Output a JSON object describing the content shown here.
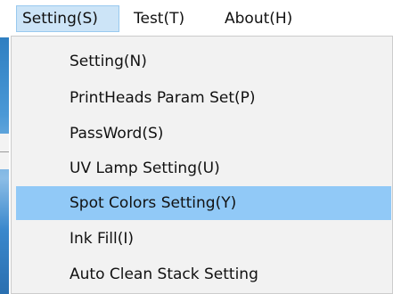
{
  "menubar": {
    "items": [
      {
        "label": "Setting(S)"
      },
      {
        "label": "Test(T)"
      },
      {
        "label": "About(H)"
      }
    ]
  },
  "dropdown": {
    "items": [
      {
        "label": "Setting(N)"
      },
      {
        "label": "PrintHeads Param Set(P)"
      },
      {
        "label": "PassWord(S)"
      },
      {
        "label": "UV Lamp Setting(U)"
      },
      {
        "label": "Spot Colors Setting(Y)",
        "highlighted": true
      },
      {
        "label": "Ink Fill(I)"
      },
      {
        "label": "Auto Clean Stack Setting"
      }
    ]
  },
  "colors": {
    "menu_active_bg": "#cce4f7",
    "item_highlight_bg": "#91c9f7",
    "dropdown_bg": "#f2f2f2"
  }
}
